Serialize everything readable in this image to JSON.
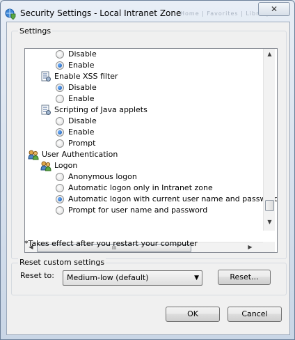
{
  "window": {
    "title": "Security Settings - Local Intranet Zone",
    "close_label": "✕",
    "background_tabs": "Home | Favorites | Library"
  },
  "settings_group": {
    "label": "Settings",
    "footnote": "*Takes effect after you restart your computer"
  },
  "tree": [
    {
      "kind": "radio",
      "label": "Disable",
      "checked": false,
      "indent": 1
    },
    {
      "kind": "radio",
      "label": "Enable",
      "checked": true,
      "indent": 1
    },
    {
      "kind": "setting",
      "label": "Enable XSS filter",
      "icon": "settings-page-icon",
      "indent": 0
    },
    {
      "kind": "radio",
      "label": "Disable",
      "checked": true,
      "indent": 1
    },
    {
      "kind": "radio",
      "label": "Enable",
      "checked": false,
      "indent": 1
    },
    {
      "kind": "setting",
      "label": "Scripting of Java applets",
      "icon": "settings-page-icon",
      "indent": 0
    },
    {
      "kind": "radio",
      "label": "Disable",
      "checked": false,
      "indent": 1
    },
    {
      "kind": "radio",
      "label": "Enable",
      "checked": true,
      "indent": 1
    },
    {
      "kind": "radio",
      "label": "Prompt",
      "checked": false,
      "indent": 1
    },
    {
      "kind": "category",
      "label": "User Authentication",
      "icon": "users-icon",
      "indent": -1
    },
    {
      "kind": "setting",
      "label": "Logon",
      "icon": "users-icon",
      "indent": 0
    },
    {
      "kind": "radio",
      "label": "Anonymous logon",
      "checked": false,
      "indent": 1
    },
    {
      "kind": "radio",
      "label": "Automatic logon only in Intranet zone",
      "checked": false,
      "indent": 1
    },
    {
      "kind": "radio",
      "label": "Automatic logon with current user name and password",
      "checked": true,
      "indent": 1
    },
    {
      "kind": "radio",
      "label": "Prompt for user name and password",
      "checked": false,
      "indent": 1
    }
  ],
  "scrollbars": {
    "up_arrow": "▲",
    "down_arrow": "▼",
    "left_arrow": "◀",
    "right_arrow": "▶",
    "h_thumb_grip": "III"
  },
  "reset_group": {
    "label": "Reset custom settings",
    "reset_to_label": "Reset to:",
    "selected_level": "Medium-low (default)",
    "dropdown_arrow": "▼",
    "reset_button": "Reset..."
  },
  "buttons": {
    "ok": "OK",
    "cancel": "Cancel"
  }
}
